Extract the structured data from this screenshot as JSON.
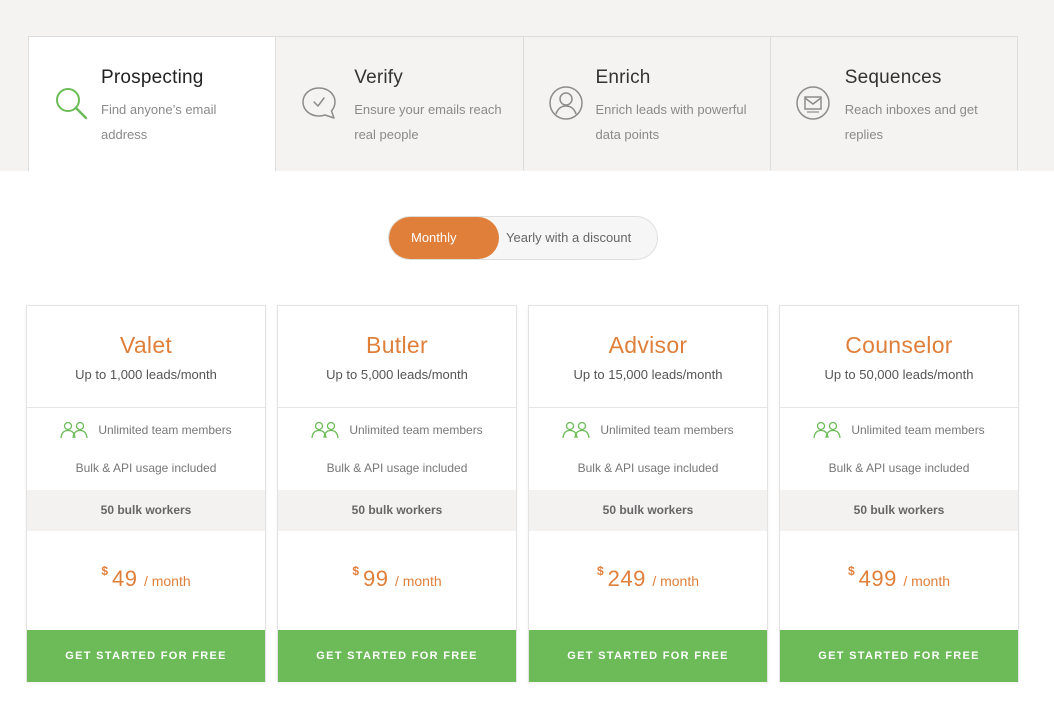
{
  "tabs": [
    {
      "title": "Prospecting",
      "desc": "Find anyone’s email address",
      "icon": "search-icon",
      "active": true
    },
    {
      "title": "Verify",
      "desc": "Ensure your emails reach real people",
      "icon": "checkmark-bubble-icon",
      "active": false
    },
    {
      "title": "Enrich",
      "desc": "Enrich leads with powerful data points",
      "icon": "user-profile-icon",
      "active": false
    },
    {
      "title": "Sequences",
      "desc": "Reach inboxes and get replies",
      "icon": "envelope-icon",
      "active": false
    }
  ],
  "billing_toggle": {
    "monthly": "Monthly",
    "yearly": "Yearly with a discount",
    "selected": "Monthly"
  },
  "plans": [
    {
      "name": "Valet",
      "leads": "Up to 1,000 leads/month",
      "team": "Unlimited team members",
      "bulk": "Bulk & API usage included",
      "workers": "50 bulk workers",
      "currency": "$",
      "price": "49",
      "period": "/ month",
      "cta": "GET STARTED FOR FREE"
    },
    {
      "name": "Butler",
      "leads": "Up to 5,000 leads/month",
      "team": "Unlimited team members",
      "bulk": "Bulk & API usage included",
      "workers": "50 bulk workers",
      "currency": "$",
      "price": "99",
      "period": "/ month",
      "cta": "GET STARTED FOR FREE"
    },
    {
      "name": "Advisor",
      "leads": "Up to 15,000 leads/month",
      "team": "Unlimited team members",
      "bulk": "Bulk & API usage included",
      "workers": "50 bulk workers",
      "currency": "$",
      "price": "249",
      "period": "/ month",
      "cta": "GET STARTED FOR FREE"
    },
    {
      "name": "Counselor",
      "leads": "Up to 50,000 leads/month",
      "team": "Unlimited team members",
      "bulk": "Bulk & API usage included",
      "workers": "50 bulk workers",
      "currency": "$",
      "price": "499",
      "period": "/ month",
      "cta": "GET STARTED FOR FREE"
    }
  ],
  "colors": {
    "accent_orange": "#df7f3a",
    "cta_green": "#6cbb58",
    "icon_green": "#6cbb58",
    "icon_gray": "#8c8c8c",
    "band_bg": "#f4f3f2"
  }
}
